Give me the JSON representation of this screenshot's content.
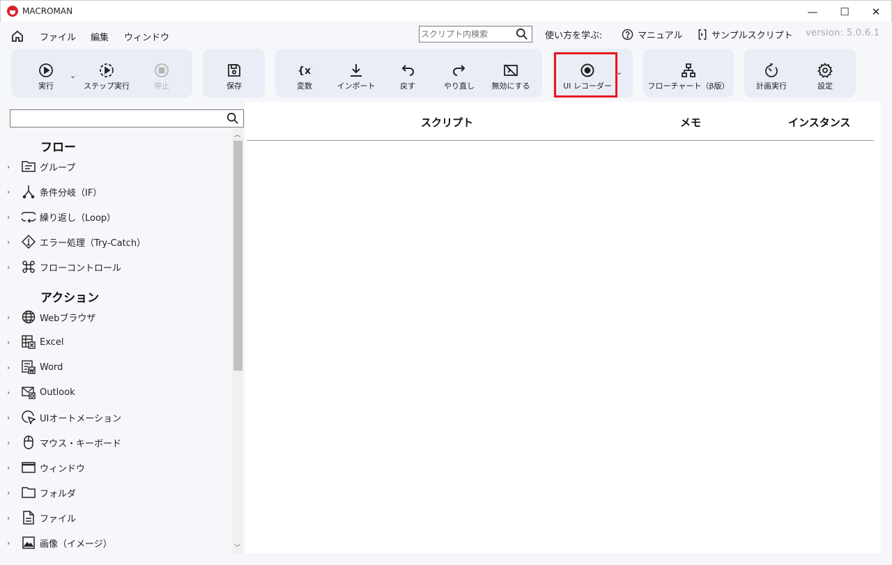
{
  "window": {
    "title": "MACROMAN",
    "controls": {
      "minimize": "—",
      "maximize": "☐",
      "close": "✕"
    }
  },
  "menu": {
    "items": [
      "ファイル",
      "編集",
      "ウィンドウ"
    ]
  },
  "top_search": {
    "placeholder": "スクリプト内検索"
  },
  "help_links": {
    "learn": "使い方を学ぶ:",
    "manual": "マニュアル",
    "samples": "サンプルスクリプト"
  },
  "version": "version: 5.0.6.1",
  "toolbar": {
    "run": "実行",
    "step_run": "ステップ実行",
    "stop": "停止",
    "save": "保存",
    "variables": "変数",
    "import": "インポート",
    "undo": "戻す",
    "redo": "やり直し",
    "disable": "無効にする",
    "ui_recorder": "UI レコーダー",
    "flowchart": "フローチャート（β版）",
    "schedule": "計画実行",
    "settings": "設定"
  },
  "sidebar": {
    "search_placeholder": "",
    "flow_title": "フロー",
    "flow_items": [
      "グループ",
      "条件分岐（IF）",
      "繰り返し（Loop）",
      "エラー処理（Try-Catch）",
      "フローコントロール"
    ],
    "action_title": "アクション",
    "action_items": [
      "Webブラウザ",
      "Excel",
      "Word",
      "Outlook",
      "UIオートメーション",
      "マウス・キーボード",
      "ウィンドウ",
      "フォルダ",
      "ファイル",
      "画像（イメージ）"
    ]
  },
  "table": {
    "columns": [
      "スクリプト",
      "メモ",
      "インスタンス"
    ]
  },
  "colors": {
    "accent_highlight": "#e8141e",
    "panel_bg": "#f6f7fb",
    "group_bg": "#e9edf5",
    "logo_red": "#d8232a"
  }
}
